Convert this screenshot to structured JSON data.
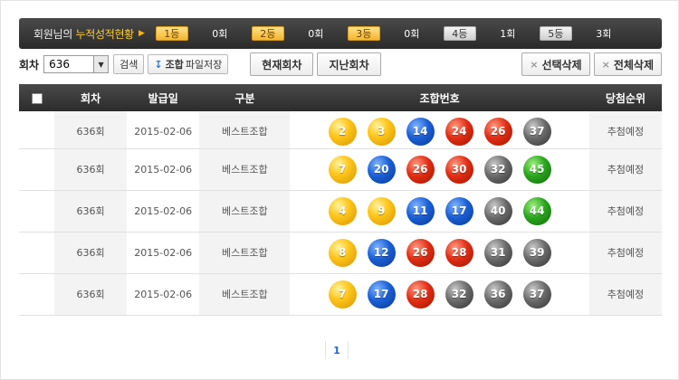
{
  "summary": {
    "prefix": "회원님의 ",
    "highlight": "누적성적현황",
    "ranks": [
      {
        "label": "1등",
        "count": "0회",
        "style": "gold"
      },
      {
        "label": "2등",
        "count": "0회",
        "style": "gold"
      },
      {
        "label": "3등",
        "count": "0회",
        "style": "gold"
      },
      {
        "label": "4등",
        "count": "1회",
        "style": "gray"
      },
      {
        "label": "5등",
        "count": "3회",
        "style": "gray"
      }
    ]
  },
  "toolbar": {
    "round_label": "회차",
    "round_value": "636",
    "search_label": "검색",
    "save_bold": "조합",
    "save_label": "파일저장",
    "current_label": "현재회차",
    "past_label": "지난회차",
    "delete_selected_label": "선택삭제",
    "delete_all_label": "전체삭제"
  },
  "table": {
    "headers": [
      "회차",
      "발급일",
      "구분",
      "조합번호",
      "당첨순위"
    ],
    "rows": [
      {
        "round": "636회",
        "date": "2015-02-06",
        "type": "베스트조합",
        "numbers": [
          2,
          3,
          14,
          24,
          26,
          37
        ],
        "rank": "추첨예정"
      },
      {
        "round": "636회",
        "date": "2015-02-06",
        "type": "베스트조합",
        "numbers": [
          7,
          20,
          26,
          30,
          32,
          45
        ],
        "rank": "추첨예정"
      },
      {
        "round": "636회",
        "date": "2015-02-06",
        "type": "베스트조합",
        "numbers": [
          4,
          9,
          11,
          17,
          40,
          44
        ],
        "rank": "추첨예정"
      },
      {
        "round": "636회",
        "date": "2015-02-06",
        "type": "베스트조합",
        "numbers": [
          8,
          12,
          26,
          28,
          31,
          39
        ],
        "rank": "추첨예정"
      },
      {
        "round": "636회",
        "date": "2015-02-06",
        "type": "베스트조합",
        "numbers": [
          7,
          17,
          28,
          32,
          36,
          37
        ],
        "rank": "추첨예정"
      }
    ]
  },
  "pagination": {
    "current": "1"
  },
  "colors": {
    "ball_1_10": "#ffc61a",
    "ball_11_20": "#1a5fd6",
    "ball_21_30": "#e22d14",
    "ball_31_40": "#6b6b6b",
    "ball_41_45": "#2aa61e",
    "header_bg": "#333333",
    "highlight": "#ffcc33"
  }
}
